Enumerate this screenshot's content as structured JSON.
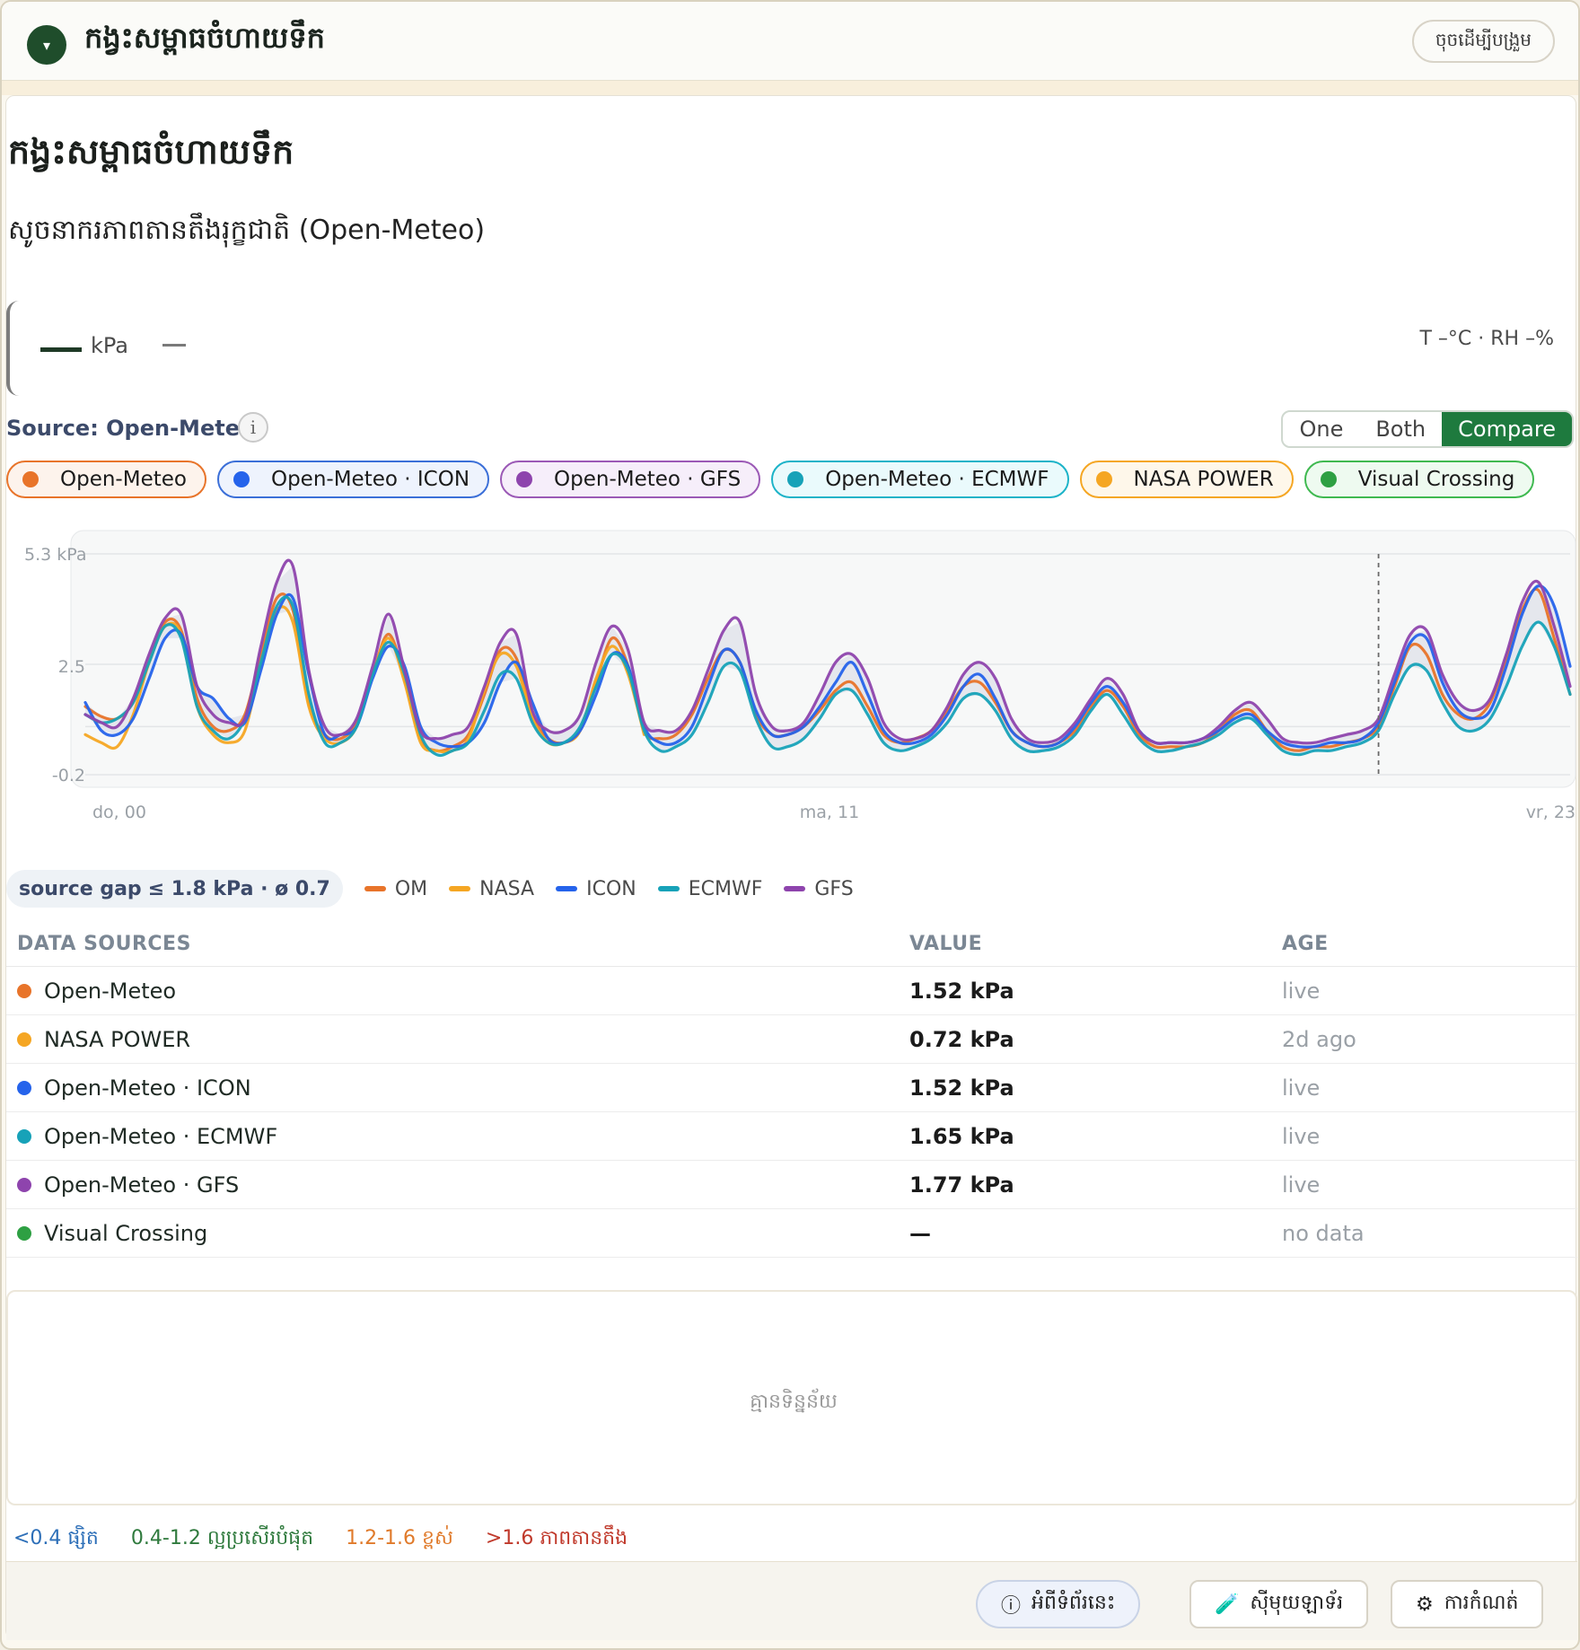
{
  "topbar": {
    "title": "កង្វះសម្ពាធចំហាយទឹក",
    "start_label": "ចុចដើម្បីបង្រួម",
    "collapse_glyph": "▾"
  },
  "panel": {
    "title": "កង្វះសម្ពាធចំហាយទឹក",
    "subtitle": "សូចនាករភាពតានតឹងរុក្ខជាតិ (Open-Meteo)"
  },
  "reading": {
    "value": "—",
    "unit": "kPa",
    "trend": "—",
    "meta": "T –°C · RH –%"
  },
  "source": {
    "label": "Source: Open-Meteo",
    "info_glyph": "i"
  },
  "modes": {
    "items": [
      "One",
      "Both",
      "Compare"
    ],
    "active": "Compare"
  },
  "chips": [
    {
      "label": "Open-Meteo",
      "color": "#e8742a",
      "border": "#e8742a",
      "bg": "#fdf3ec"
    },
    {
      "label": "Open-Meteo · ICON",
      "color": "#2563eb",
      "border": "#3b6fd8",
      "bg": "#eef3fd"
    },
    {
      "label": "Open-Meteo · GFS",
      "color": "#8e44ad",
      "border": "#9b59b6",
      "bg": "#f6eefa"
    },
    {
      "label": "Open-Meteo · ECMWF",
      "color": "#17a2b8",
      "border": "#1cb3c8",
      "bg": "#eafafc"
    },
    {
      "label": "NASA POWER",
      "color": "#f5a623",
      "border": "#f5a623",
      "bg": "#fef7ea"
    },
    {
      "label": "Visual Crossing",
      "color": "#2ea043",
      "border": "#3fb950",
      "bg": "#eefaf0"
    }
  ],
  "chart_data": {
    "type": "line",
    "ylim": [
      -0.2,
      5.3
    ],
    "y_ticks": [
      "5.3 kPa",
      "2.5",
      "-0.2"
    ],
    "x_ticks": [
      "do, 00",
      "ma, 11",
      "vr, 23"
    ],
    "now_marker_hour": 81,
    "series": [
      {
        "name": "OM",
        "color": "#e8742a",
        "values": [
          1.5,
          1.25,
          1.2,
          1.6,
          2.6,
          3.6,
          3.4,
          1.7,
          1.0,
          0.9,
          1.3,
          2.8,
          4.2,
          3.9,
          1.6,
          0.8,
          0.7,
          1.1,
          2.3,
          3.3,
          2.2,
          0.7,
          0.4,
          0.5,
          0.8,
          1.8,
          2.9,
          2.7,
          1.3,
          0.7,
          0.6,
          0.9,
          2.1,
          3.2,
          2.5,
          0.9,
          0.7,
          0.8,
          1.3,
          2.2,
          2.9,
          2.6,
          1.3,
          0.8,
          0.8,
          1.0,
          1.4,
          1.9,
          2.1,
          1.5,
          0.8,
          0.6,
          0.7,
          0.9,
          1.4,
          2.0,
          2.1,
          1.6,
          0.9,
          0.6,
          0.5,
          0.6,
          0.9,
          1.5,
          1.9,
          1.5,
          0.8,
          0.5,
          0.5,
          0.5,
          0.6,
          0.9,
          1.3,
          1.4,
          0.9,
          0.5,
          0.4,
          0.5,
          0.5,
          0.6,
          0.7,
          1.0,
          2.0,
          3.0,
          2.8,
          1.8,
          1.3,
          1.2,
          1.6,
          2.7,
          3.9,
          4.4,
          3.2,
          1.8
        ]
      },
      {
        "name": "NASA",
        "color": "#f5a623",
        "values": [
          0.8,
          0.6,
          0.5,
          1.3,
          2.6,
          3.5,
          3.3,
          1.5,
          0.8,
          0.6,
          0.9,
          2.6,
          3.9,
          3.6,
          1.5,
          0.7,
          0.6,
          1.0,
          2.3,
          3.2,
          2.1,
          0.6,
          0.4,
          0.4,
          0.7,
          1.9,
          2.8,
          2.5,
          1.2,
          0.6,
          0.6,
          0.9,
          2.2,
          3.0,
          2.3,
          0.8
        ]
      },
      {
        "name": "ICON",
        "color": "#2563eb",
        "values": [
          1.6,
          0.9,
          0.8,
          1.2,
          2.2,
          3.2,
          3.3,
          2.0,
          1.7,
          1.2,
          1.1,
          2.4,
          3.8,
          4.2,
          2.3,
          0.8,
          0.8,
          1.0,
          2.2,
          3.0,
          2.5,
          1.0,
          0.6,
          0.5,
          0.6,
          1.1,
          2.1,
          2.6,
          1.6,
          0.7,
          0.6,
          0.9,
          1.8,
          2.8,
          2.5,
          1.0,
          0.6,
          0.6,
          1.0,
          2.0,
          2.9,
          2.6,
          1.4,
          0.8,
          0.8,
          1.0,
          1.5,
          2.1,
          2.6,
          1.8,
          0.9,
          0.6,
          0.6,
          0.8,
          1.3,
          2.0,
          2.3,
          1.7,
          0.9,
          0.6,
          0.5,
          0.6,
          1.0,
          1.6,
          2.0,
          1.6,
          0.9,
          0.6,
          0.6,
          0.6,
          0.7,
          0.9,
          1.2,
          1.3,
          0.9,
          0.6,
          0.5,
          0.5,
          0.6,
          0.6,
          0.7,
          1.1,
          2.1,
          3.1,
          3.2,
          2.1,
          1.4,
          1.2,
          1.4,
          2.5,
          3.8,
          4.5,
          4.0,
          2.5
        ]
      },
      {
        "name": "ECMWF",
        "color": "#17a2b8",
        "values": [
          1.3,
          1.1,
          1.2,
          1.6,
          2.6,
          3.5,
          3.2,
          1.5,
          0.9,
          0.7,
          1.2,
          2.6,
          4.0,
          4.0,
          1.8,
          0.6,
          0.6,
          1.0,
          2.3,
          3.1,
          2.3,
          0.8,
          0.3,
          0.4,
          0.6,
          1.4,
          2.3,
          2.2,
          1.1,
          0.6,
          0.6,
          1.0,
          2.0,
          2.8,
          2.4,
          0.9,
          0.4,
          0.5,
          0.8,
          1.6,
          2.5,
          2.4,
          1.2,
          0.5,
          0.5,
          0.7,
          1.2,
          1.8,
          1.9,
          1.3,
          0.6,
          0.4,
          0.5,
          0.7,
          1.1,
          1.7,
          1.8,
          1.4,
          0.7,
          0.4,
          0.4,
          0.5,
          0.8,
          1.4,
          1.8,
          1.3,
          0.7,
          0.4,
          0.4,
          0.5,
          0.6,
          0.8,
          1.1,
          1.2,
          0.8,
          0.4,
          0.3,
          0.4,
          0.4,
          0.5,
          0.6,
          0.9,
          1.8,
          2.5,
          2.4,
          1.6,
          1.0,
          0.9,
          1.2,
          2.0,
          3.0,
          3.6,
          3.0,
          1.8
        ]
      },
      {
        "name": "GFS",
        "color": "#8e44ad",
        "values": [
          1.3,
          1.1,
          1.0,
          1.7,
          2.8,
          3.7,
          3.8,
          2.0,
          1.3,
          1.1,
          1.2,
          3.0,
          4.6,
          5.0,
          2.4,
          1.0,
          0.8,
          1.2,
          2.5,
          3.8,
          2.4,
          0.9,
          0.7,
          0.8,
          1.0,
          2.0,
          3.1,
          3.3,
          1.4,
          0.9,
          0.9,
          1.3,
          2.6,
          3.5,
          2.9,
          1.1,
          0.9,
          0.9,
          1.4,
          2.4,
          3.4,
          3.6,
          1.8,
          1.0,
          0.9,
          1.1,
          1.8,
          2.6,
          2.8,
          2.2,
          1.1,
          0.7,
          0.7,
          0.9,
          1.5,
          2.3,
          2.6,
          2.2,
          1.2,
          0.7,
          0.6,
          0.7,
          1.1,
          1.7,
          2.2,
          1.8,
          0.9,
          0.6,
          0.6,
          0.6,
          0.7,
          1.0,
          1.4,
          1.6,
          1.2,
          0.7,
          0.6,
          0.6,
          0.7,
          0.8,
          0.9,
          1.2,
          2.3,
          3.3,
          3.4,
          2.3,
          1.6,
          1.4,
          1.7,
          2.8,
          4.1,
          4.6,
          3.5,
          2.0
        ]
      }
    ]
  },
  "summary": {
    "gap_label": "source gap",
    "gap_text": "≤ 1.8 kPa · ø 0.7"
  },
  "legend": [
    {
      "label": "OM",
      "color": "#e8742a"
    },
    {
      "label": "NASA",
      "color": "#f5a623"
    },
    {
      "label": "ICON",
      "color": "#2563eb"
    },
    {
      "label": "ECMWF",
      "color": "#17a2b8"
    },
    {
      "label": "GFS",
      "color": "#8e44ad"
    }
  ],
  "table": {
    "headers": [
      "DATA SOURCES",
      "VALUE",
      "AGE"
    ],
    "rows": [
      {
        "source": "Open-Meteo",
        "color": "#e8742a",
        "value": "1.52 kPa",
        "age": "live"
      },
      {
        "source": "NASA POWER",
        "color": "#f5a623",
        "value": "0.72 kPa",
        "age": "2d ago"
      },
      {
        "source": "Open-Meteo · ICON",
        "color": "#2563eb",
        "value": "1.52 kPa",
        "age": "live"
      },
      {
        "source": "Open-Meteo · ECMWF",
        "color": "#17a2b8",
        "value": "1.65 kPa",
        "age": "live"
      },
      {
        "source": "Open-Meteo · GFS",
        "color": "#8e44ad",
        "value": "1.77 kPa",
        "age": "live"
      },
      {
        "source": "Visual Crossing",
        "color": "#2ea043",
        "value": "—",
        "age": "no data"
      }
    ]
  },
  "empty_state": "គ្មានទិន្នន័យ",
  "scale": [
    {
      "label": "<0.4 ផ្សិត",
      "color": "#2d6fb8"
    },
    {
      "label": "0.4-1.2 ល្អប្រសើរបំផុត",
      "color": "#2f7a3d"
    },
    {
      "label": "1.2-1.6 ខ្ពស់",
      "color": "#e07a2a"
    },
    {
      "label": ">1.6 ភាពតានតឹង",
      "color": "#c0392b"
    }
  ],
  "footer": {
    "about": "អំពីទំព័រនេះ",
    "about_icon": "ⓘ",
    "lab": "ស៊ីមុយឡាទ័រ",
    "lab_icon": "🧪",
    "settings": "ការកំណត់",
    "settings_icon": "⚙"
  }
}
